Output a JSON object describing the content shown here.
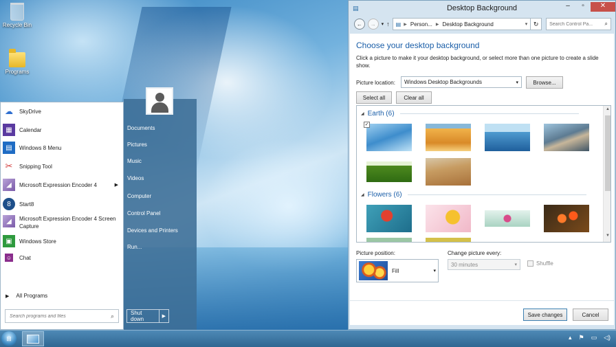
{
  "desktop": {
    "icons": [
      {
        "label": "Recycle Bin",
        "icon": "recycle-bin-icon"
      },
      {
        "label": "Programs",
        "icon": "folder-icon"
      }
    ]
  },
  "start_menu": {
    "programs": [
      {
        "label": "SkyDrive",
        "icon": "cloud-icon",
        "color": "#2f6fd0"
      },
      {
        "label": "Calendar",
        "icon": "calendar-icon",
        "color": "#5a3aa0"
      },
      {
        "label": "Windows 8 Menu",
        "icon": "windows-menu-icon",
        "color": "#1f6cc4"
      },
      {
        "label": "Snipping Tool",
        "icon": "scissors-icon",
        "color": "#d23a3a"
      },
      {
        "label": "Microsoft Expression Encoder 4",
        "icon": "encoder-icon",
        "color": "#7a5aa8",
        "has_submenu": true
      },
      {
        "label": "Start8",
        "icon": "start8-icon",
        "color": "#1d4f8a"
      },
      {
        "label": "Microsoft Expression Encoder 4 Screen Capture",
        "icon": "screen-capture-icon",
        "color": "#7a5aa8"
      },
      {
        "label": "Windows Store",
        "icon": "store-icon",
        "color": "#2e9a3e"
      },
      {
        "label": "Chat",
        "icon": "chat-icon",
        "color": "#8a2d8c"
      }
    ],
    "all_programs": "All Programs",
    "search_placeholder": "Search programs and files",
    "places": [
      "Documents",
      "Pictures",
      "Music",
      "Videos",
      "Computer",
      "Control Panel",
      "Devices and Printers",
      "Run..."
    ],
    "shutdown_label": "Shut down"
  },
  "window": {
    "title": "Desktop Background",
    "breadcrumb": [
      "Person...",
      "Desktop Background"
    ],
    "search_placeholder": "Search Control Pa...",
    "heading": "Choose your desktop background",
    "description": "Click a picture to make it your desktop background, or select more than one picture to create a slide show.",
    "picture_location_label": "Picture location:",
    "picture_location_value": "Windows Desktop Backgrounds",
    "browse_label": "Browse...",
    "select_all_label": "Select all",
    "clear_all_label": "Clear all",
    "groups": [
      {
        "name": "Earth (6)",
        "count": 6
      },
      {
        "name": "Flowers (6)",
        "count": 6
      }
    ],
    "picture_position_label": "Picture position:",
    "picture_position_value": "Fill",
    "change_every_label": "Change picture every:",
    "change_every_value": "30 minutes",
    "shuffle_label": "Shuffle",
    "save_label": "Save changes",
    "cancel_label": "Cancel"
  }
}
